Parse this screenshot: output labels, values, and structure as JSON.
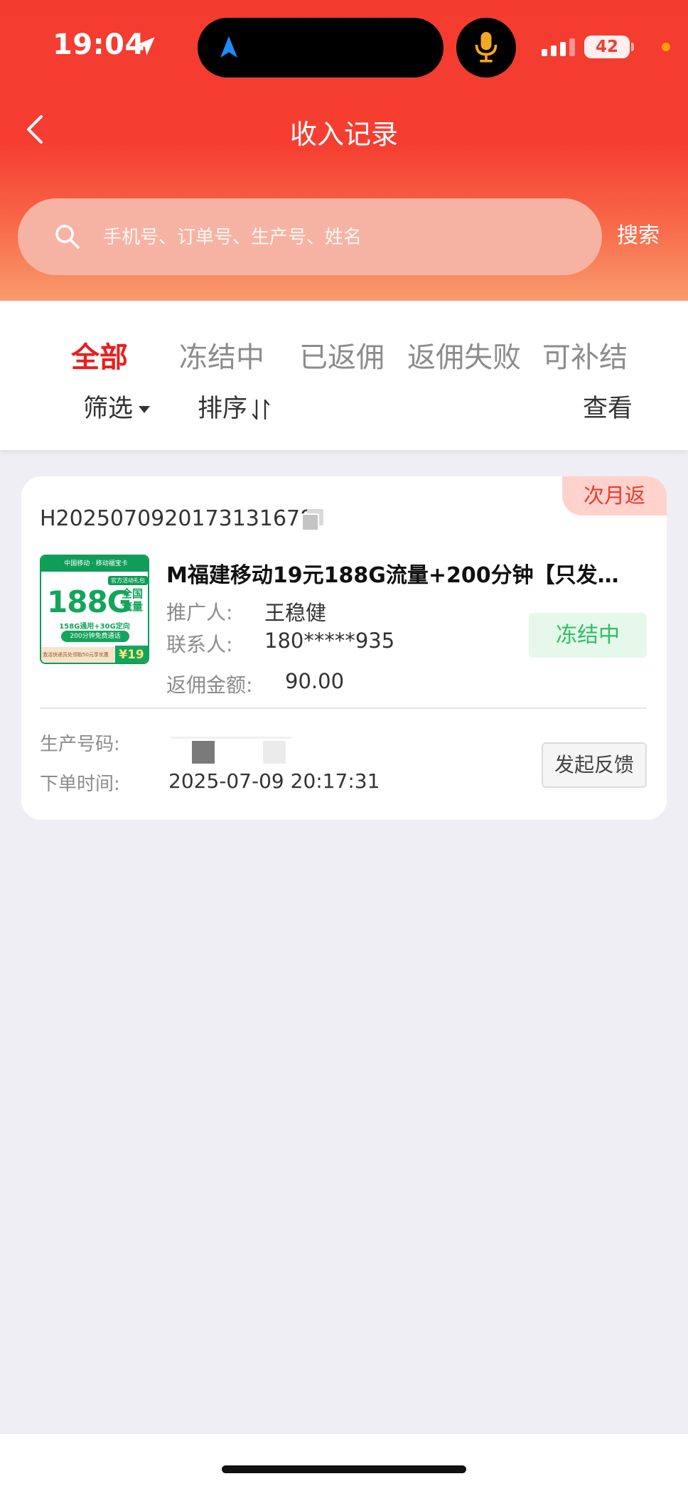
{
  "status_bar": {
    "time": "19:04",
    "battery": "42"
  },
  "nav": {
    "title": "收入记录"
  },
  "search": {
    "placeholder": "手机号、订单号、生产号、姓名",
    "button_label": "搜索"
  },
  "tabs": [
    {
      "label": "全部",
      "active": true
    },
    {
      "label": "冻结中",
      "active": false
    },
    {
      "label": "已返佣",
      "active": false
    },
    {
      "label": "返佣失败",
      "active": false
    },
    {
      "label": "可补结",
      "active": false
    }
  ],
  "toolbar": {
    "filter_label": "筛选",
    "sort_label": "排序",
    "view_label": "查看"
  },
  "record": {
    "badge": "次月返",
    "order_no": "H2025070920173131678",
    "title": "M福建移动19元188G流量+200分钟【只发福…",
    "promoter_label": "推广人:",
    "promoter_value": "王稳健",
    "contact_label": "联系人:",
    "contact_value": "180*****935",
    "commission_label": "返佣金额:",
    "commission_value": "90.00",
    "status": "冻结中",
    "production_label": "生产号码:",
    "order_time_label": "下单时间:",
    "order_time_value": "2025-07-09 20:17:31",
    "feedback_label": "发起反馈",
    "image": {
      "top_text": "中国移动 · 移动福宝卡",
      "tag": "官方活动礼包",
      "big": "188G",
      "side": "全国流量",
      "line1": "158G通用+30G定向",
      "line2": "200分钟免费通话",
      "bottom": "激活快递员处领取50元享优惠",
      "price": "¥19"
    }
  },
  "colors": {
    "header_red": "#f43b2f",
    "accent_red": "#ea1e1e",
    "status_green": "#2fbf63",
    "badge_bg": "#ffd2cc"
  }
}
